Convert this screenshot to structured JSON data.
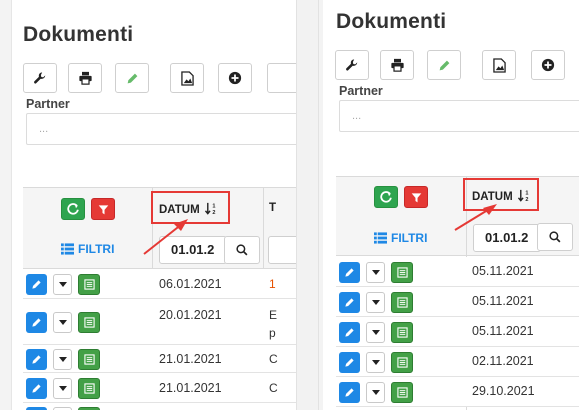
{
  "left": {
    "title": "Dokumenti",
    "partner_label": "Partner",
    "partner_placeholder": "...",
    "table": {
      "datum_header": "DATUM",
      "next_col_header": "T",
      "filtri_label": "FILTRI",
      "date_filter_value": "01.01.2",
      "rows": [
        {
          "date": "06.01.2021",
          "extra": "1",
          "extra2": ""
        },
        {
          "date": "20.01.2021",
          "extra": "E",
          "extra2": "p"
        },
        {
          "date": "21.01.2021",
          "extra": "C",
          "extra2": ""
        },
        {
          "date": "21.01.2021",
          "extra": "C",
          "extra2": ""
        },
        {
          "date": "",
          "extra": "",
          "extra2": ""
        }
      ]
    }
  },
  "right": {
    "title": "Dokumenti",
    "partner_label": "Partner",
    "partner_placeholder": "...",
    "table": {
      "datum_header": "DATUM",
      "filtri_label": "FILTRI",
      "date_filter_value": "01.01.2",
      "rows": [
        {
          "date": "05.11.2021"
        },
        {
          "date": "05.11.2021"
        },
        {
          "date": "05.11.2021"
        },
        {
          "date": "02.11.2021"
        },
        {
          "date": "29.10.2021"
        }
      ]
    }
  },
  "colors": {
    "highlight_red": "#e53935",
    "primary_blue": "#1e88e5",
    "success_green": "#2ea44f",
    "danger_red": "#e53935"
  },
  "icons": [
    "wrench-icon",
    "print-icon",
    "pencil-icon",
    "file-image-icon",
    "plus-circle-icon",
    "refresh-icon",
    "filter-icon",
    "list-icon",
    "search-icon",
    "sort-numeric-icon",
    "caret-down-icon",
    "document-list-icon"
  ]
}
